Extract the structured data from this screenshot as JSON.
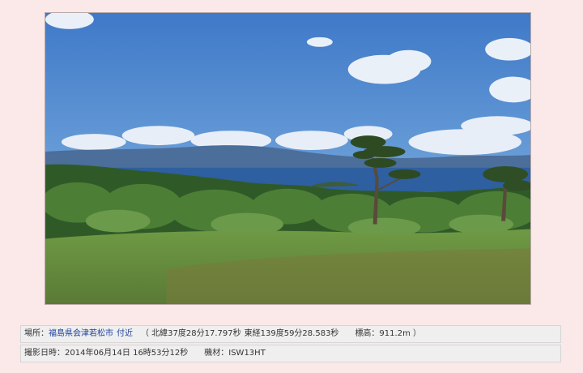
{
  "location": {
    "label": "場所：",
    "place": "福島県会津若松市",
    "vicinity": "付近",
    "lat": "（ 北緯37度28分17.797秒",
    "lon": "東経139度59分28.583秒",
    "alt": "標高：911.2m ）"
  },
  "shot": {
    "datetime": "撮影日時：2014年06月14日 16時53分12秒",
    "device": "機材：ISW13HT"
  }
}
